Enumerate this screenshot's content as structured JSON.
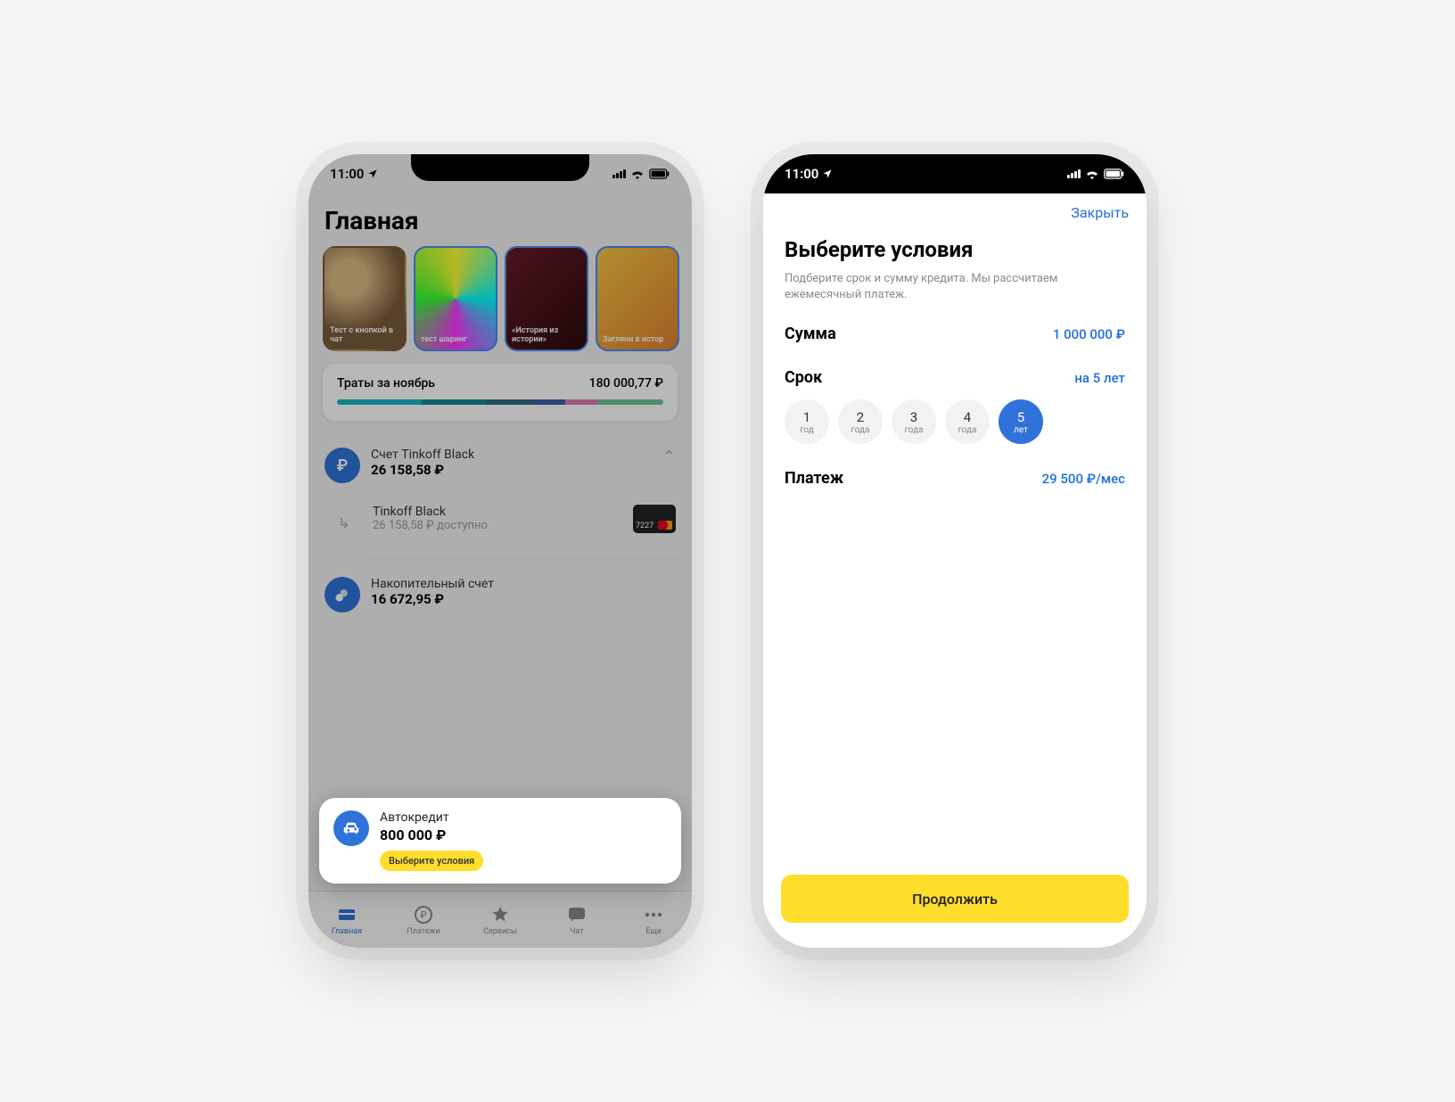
{
  "status": {
    "time": "11:00"
  },
  "phone1": {
    "title": "Главная",
    "stories": [
      {
        "label": "Тест с кнопкой в чат"
      },
      {
        "label": "тест шаринг"
      },
      {
        "label": "«История из истории»"
      },
      {
        "label": "Загляни в истор"
      }
    ],
    "spend": {
      "label": "Траты за ноябрь",
      "amount": "180 000,77 ₽"
    },
    "account1": {
      "name": "Счет Tinkoff Black",
      "balance": "26 158,58 ₽"
    },
    "account1sub": {
      "name": "Tinkoff Black",
      "available": "26 158,58 ₽ доступно",
      "card_last4": "7227"
    },
    "account2": {
      "name": "Накопительный счет",
      "balance": "16 672,95 ₽"
    },
    "autoloan": {
      "title": "Автокредит",
      "amount": "800 000 ₽",
      "badge": "Выберите условия"
    },
    "tabs": [
      "Главная",
      "Платежи",
      "Сервисы",
      "Чат",
      "Еще"
    ]
  },
  "phone2": {
    "close": "Закрыть",
    "title": "Выберите условия",
    "desc": "Подберите срок и сумму кредита. Мы рассчитаем ежемесячный платеж.",
    "amount": {
      "label": "Сумма",
      "value": "1 000 000 ₽"
    },
    "term": {
      "label": "Срок",
      "value": "на 5 лет",
      "options": [
        {
          "num": "1",
          "unit": "год"
        },
        {
          "num": "2",
          "unit": "года"
        },
        {
          "num": "3",
          "unit": "года"
        },
        {
          "num": "4",
          "unit": "года"
        },
        {
          "num": "5",
          "unit": "лет"
        }
      ],
      "selected_index": 4
    },
    "payment": {
      "label": "Платеж",
      "value": "29 500 ₽/мес"
    },
    "continue": "Продолжить"
  }
}
